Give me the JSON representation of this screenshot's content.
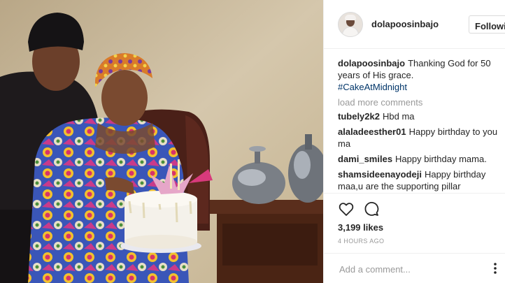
{
  "post": {
    "image_alt": "photo",
    "author": "dolapoosinbajo",
    "follow_label": "Following",
    "caption_user": "dolapoosinbajo",
    "caption_text": "Thanking God for 50 years of His grace.",
    "hashtag": "#CakeAtMidnight",
    "load_more_label": "load more comments",
    "comments": [
      {
        "user": "tubely2k2",
        "text": "Hbd ma"
      },
      {
        "user": "alaladeesther01",
        "text": "Happy birthday to you ma"
      },
      {
        "user": "dami_smiles",
        "text": "Happy birthday mama."
      },
      {
        "user": "shamsideenayodeji",
        "text": "Happy birthday maa,u are the supporting pillar ALMIGHTY GOD gave to our active acting president, this is true love relationship when things are"
      }
    ],
    "likes": "3,199 likes",
    "time": "4 HOURS AGO",
    "comment_placeholder": "Add a comment..."
  },
  "icons": {
    "like": "heart-icon",
    "comment": "comment-bubble-icon",
    "more": "more-options-icon"
  },
  "colors": {
    "link_blue": "#003569",
    "muted_gray": "#999999",
    "text_dark": "#262626",
    "border": "#efefef"
  }
}
